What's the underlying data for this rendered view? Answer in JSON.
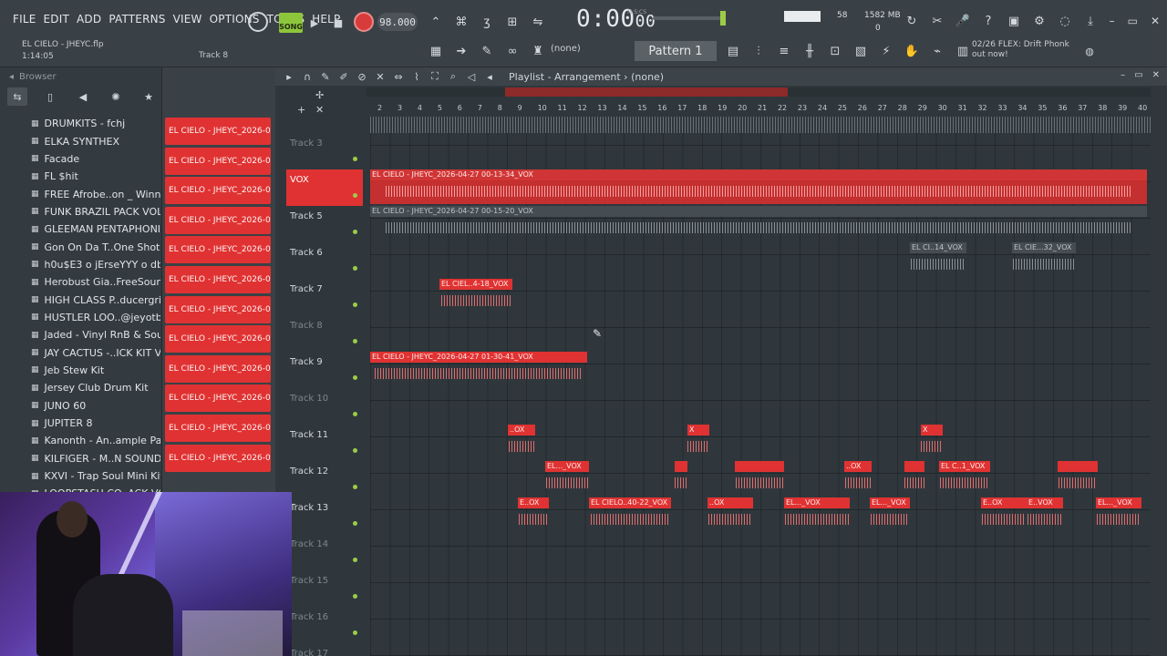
{
  "menu": [
    "FILE",
    "EDIT",
    "ADD",
    "PATTERNS",
    "VIEW",
    "OPTIONS",
    "TOOLS",
    "HELP"
  ],
  "project": {
    "title": "EL CIELO - JHEYC.flp",
    "time": "1:14:05",
    "track": "Track 8"
  },
  "transport": {
    "mode": "SONG",
    "tempo": "98.000",
    "time": "0:00",
    "time_sub": "00",
    "time_label": "M:S:CS"
  },
  "monitor": {
    "cpu": "58",
    "memory": "1582 MB",
    "poly": "0"
  },
  "toolbar": {
    "none_label": "(none)",
    "pattern": "Pattern 1"
  },
  "news": {
    "count": "02/26",
    "text": "FLEX: Drift Phonk out now!"
  },
  "browser": {
    "title": "Browser",
    "items": [
      "DRUMKITS - fchj",
      "ELKA SYNTHEX",
      "Facade",
      "FL $hit",
      "FREE Afrobe..on _ Winner)",
      "FUNK BRAZIL PACK VOL II",
      "GLEEMAN PENTAPHONIC",
      "Gon On Da T..One Shot Kit",
      "h0u$E3 o jErseYYY o db",
      "Herobust Gia..FreeSounds1",
      "HIGH CLASS P..ducergrind)",
      "HUSTLER LOO..@jeyotb808",
      "Jaded - Vinyl RnB & Soul",
      "JAY CACTUS -..ICK KIT VOL. 4",
      "Jeb Stew Kit",
      "Jersey Club Drum Kit",
      "JUNO 60",
      "JUPITER 8",
      "Kanonth - An..ample Pack!!",
      "KILFIGER - M..N SOUND KIT",
      "KXVI - Trap Soul Mini Kit",
      "LOOPSTASH CO..ACK VOL. 1"
    ]
  },
  "channels": [
    "EL CIELO - JHEYC_2026-0",
    "EL CIELO - JHEYC_2026-0",
    "EL CIELO - JHEYC_2026-0",
    "EL CIELO - JHEYC_2026-0",
    "EL CIELO - JHEYC_2026-0",
    "EL CIELO - JHEYC_2026-0",
    "EL CIELO - JHEYC_2026-0",
    "EL CIELO - JHEYC_2026-0",
    "EL CIELO - JHEYC_2026-0",
    "EL CIELO - JHEYC_2026-0",
    "EL CIELO - JHEYC_2026-0",
    "EL CIELO - JHEYC_2026-0"
  ],
  "playlist": {
    "title": "Playlist - Arrangement",
    "pattern": "(none)",
    "ruler": [
      "2",
      "3",
      "4",
      "5",
      "6",
      "7",
      "8",
      "9",
      "10",
      "11",
      "12",
      "13",
      "14",
      "15",
      "16",
      "17",
      "18",
      "19",
      "20",
      "21",
      "22",
      "23",
      "24",
      "25",
      "26",
      "27",
      "28",
      "29",
      "30",
      "31",
      "32",
      "33",
      "34",
      "35",
      "36",
      "37",
      "38",
      "39",
      "40"
    ],
    "tracks": [
      {
        "name": "Track 3",
        "empty": true
      },
      {
        "name": "VOX",
        "empty": false,
        "vox": true
      },
      {
        "name": "Track 5",
        "empty": false
      },
      {
        "name": "Track 6",
        "empty": false
      },
      {
        "name": "Track 7",
        "empty": false
      },
      {
        "name": "Track 8",
        "empty": true
      },
      {
        "name": "Track 9",
        "empty": false
      },
      {
        "name": "Track 10",
        "empty": true
      },
      {
        "name": "Track 11",
        "empty": false
      },
      {
        "name": "Track 12",
        "empty": false
      },
      {
        "name": "Track 13",
        "empty": false
      },
      {
        "name": "Track 14",
        "empty": true
      },
      {
        "name": "Track 15",
        "empty": true
      },
      {
        "name": "Track 16",
        "empty": true
      },
      {
        "name": "Track 17",
        "empty": true
      }
    ],
    "clips": {
      "vox": "EL CIELO - JHEYC_2026-04-27 00-13-34_VOX",
      "t5": "EL CIELO - JHEYC_2026-04-27 00-15-20_VOX",
      "t6a": "EL CI..14_VOX",
      "t6b": "EL CIE...32_VOX",
      "t7": "EL CIEL..4-18_VOX",
      "t9": "EL CIELO - JHEYC_2026-04-27 01-30-41_VOX",
      "t11a": "..OX",
      "t11b": "X",
      "t11c": "X",
      "t12a": "EL..._VOX",
      "t12b": "..OX",
      "t12c": "EL C..1_VOX",
      "t13a": "E..OX",
      "t13b": "EL CIELO..40-22_VOX",
      "t13c": "..OX",
      "t13d": "EL..._VOX",
      "t13e": "EL..._VOX",
      "t13f": "E..OX",
      "t13g": "E..VOX",
      "t13h": "EL..._VOX"
    }
  },
  "colors": {
    "accent": "#e03232",
    "song_mode": "#8ec63b"
  }
}
